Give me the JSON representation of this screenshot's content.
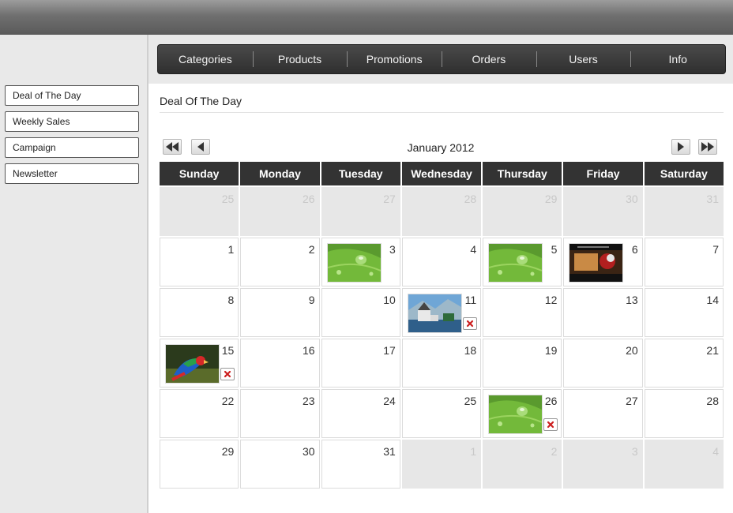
{
  "sidebar": {
    "items": [
      {
        "label": "Deal of The Day"
      },
      {
        "label": "Weekly Sales"
      },
      {
        "label": "Campaign"
      },
      {
        "label": "Newsletter"
      }
    ]
  },
  "nav": {
    "items": [
      {
        "label": "Categories"
      },
      {
        "label": "Products"
      },
      {
        "label": "Promotions"
      },
      {
        "label": "Orders"
      },
      {
        "label": "Users"
      },
      {
        "label": "Info"
      }
    ]
  },
  "panel": {
    "title": "Deal Of The Day"
  },
  "calendar": {
    "month_label": "January 2012",
    "day_headers": [
      "Sunday",
      "Monday",
      "Tuesday",
      "Wednesday",
      "Thursday",
      "Friday",
      "Saturday"
    ],
    "weeks": [
      [
        {
          "d": "25",
          "o": true
        },
        {
          "d": "26",
          "o": true
        },
        {
          "d": "27",
          "o": true
        },
        {
          "d": "28",
          "o": true
        },
        {
          "d": "29",
          "o": true
        },
        {
          "d": "30",
          "o": true
        },
        {
          "d": "31",
          "o": true
        }
      ],
      [
        {
          "d": "1"
        },
        {
          "d": "2"
        },
        {
          "d": "3",
          "img": "leaf"
        },
        {
          "d": "4"
        },
        {
          "d": "5",
          "img": "leaf"
        },
        {
          "d": "6",
          "img": "dark"
        },
        {
          "d": "7"
        }
      ],
      [
        {
          "d": "8"
        },
        {
          "d": "9"
        },
        {
          "d": "10"
        },
        {
          "d": "11",
          "img": "castle",
          "del": true
        },
        {
          "d": "12"
        },
        {
          "d": "13"
        },
        {
          "d": "14"
        }
      ],
      [
        {
          "d": "15",
          "img": "parrot",
          "del": true
        },
        {
          "d": "16"
        },
        {
          "d": "17"
        },
        {
          "d": "18"
        },
        {
          "d": "19"
        },
        {
          "d": "20"
        },
        {
          "d": "21"
        }
      ],
      [
        {
          "d": "22"
        },
        {
          "d": "23"
        },
        {
          "d": "24"
        },
        {
          "d": "25"
        },
        {
          "d": "26",
          "img": "leaf",
          "del": true
        },
        {
          "d": "27"
        },
        {
          "d": "28"
        }
      ],
      [
        {
          "d": "29"
        },
        {
          "d": "30"
        },
        {
          "d": "31"
        },
        {
          "d": "1",
          "o": true
        },
        {
          "d": "2",
          "o": true
        },
        {
          "d": "3",
          "o": true
        },
        {
          "d": "4",
          "o": true
        }
      ]
    ]
  }
}
